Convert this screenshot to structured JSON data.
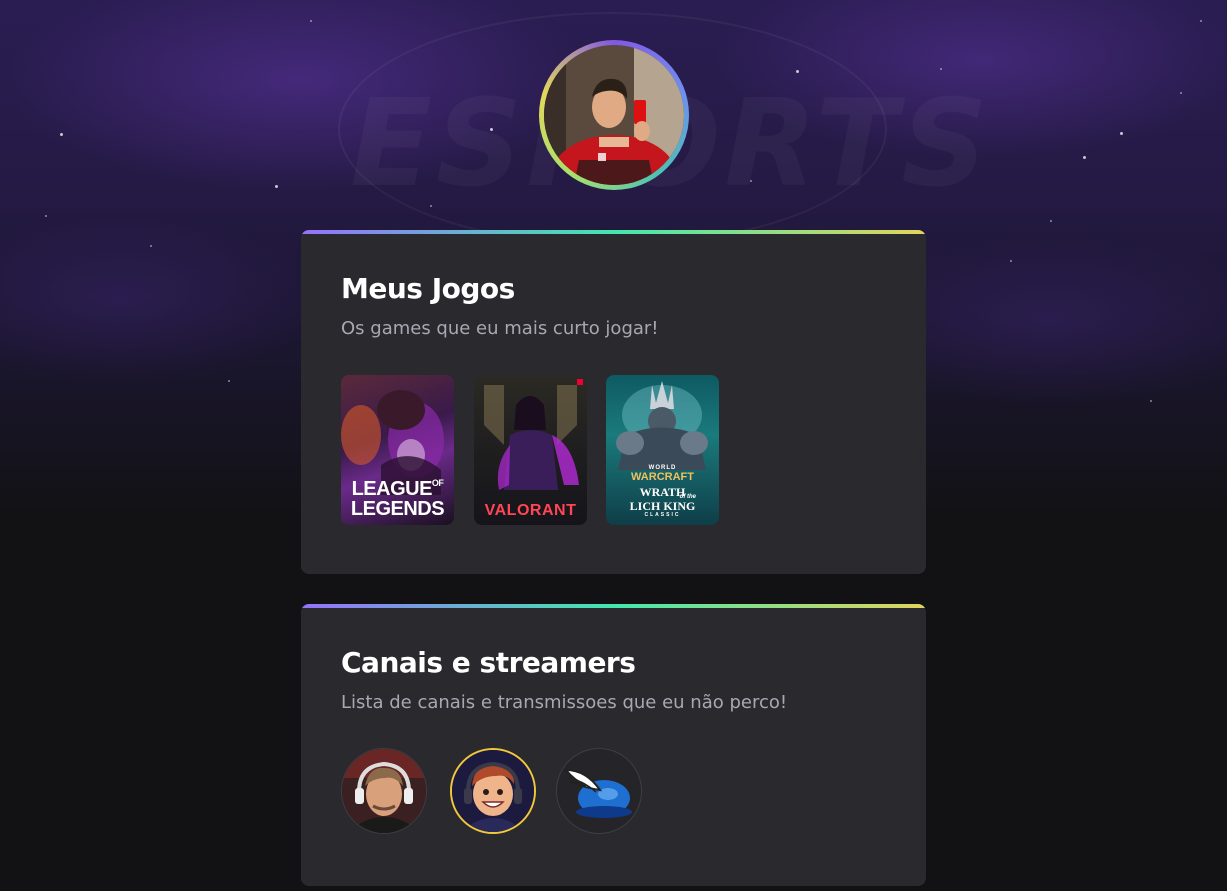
{
  "background": {
    "art_text": "ESPORTS"
  },
  "profile": {
    "avatar_icon": "profile-photo"
  },
  "colors": {
    "card_bg": "#29292e",
    "accent_gradient": [
      "#9572fc",
      "#43e7ad",
      "#e2d45c"
    ]
  },
  "games_section": {
    "title": "Meus Jogos",
    "subtitle": "Os games que eu mais curto jogar!",
    "games": [
      {
        "name": "League of Legends",
        "logo_line1": "LEAGUE",
        "logo_of": "OF",
        "logo_line2": "LEGENDS"
      },
      {
        "name": "Valorant",
        "logo": "VALORANT"
      },
      {
        "name": "World of Warcraft Wrath of the Lich King Classic",
        "logo_top": "WORLD",
        "logo_brand": "WARCRAFT",
        "logo_main1": "WRATH",
        "logo_of": "of the",
        "logo_main2": "LICH KING",
        "logo_sub": "CLASSIC"
      }
    ]
  },
  "channels_section": {
    "title": "Canais e streamers",
    "subtitle": "Lista de canais e transmissoes que eu não perco!",
    "channels": [
      {
        "icon": "streamer-headset-avatar"
      },
      {
        "icon": "cartoon-streamer-avatar"
      },
      {
        "icon": "winged-helmet-logo"
      }
    ]
  }
}
